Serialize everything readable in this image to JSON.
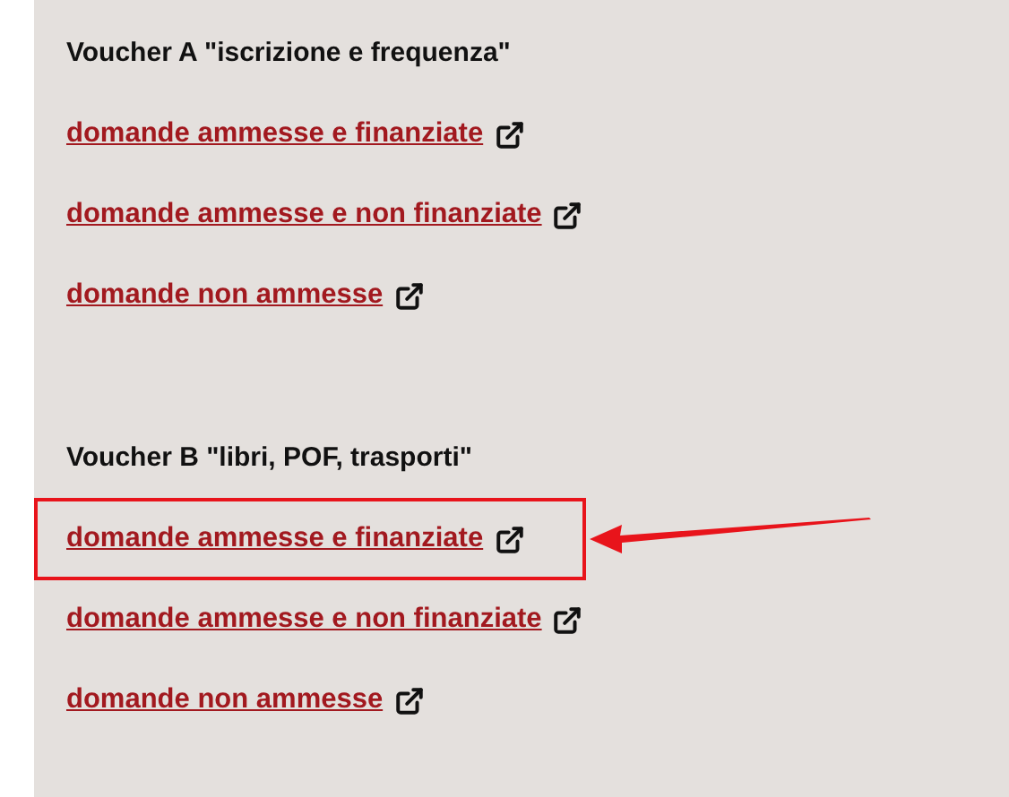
{
  "sections": [
    {
      "title": "Voucher A \"iscrizione e frequenza\"",
      "links": [
        {
          "label": "domande ammesse e finanziate",
          "highlighted": false
        },
        {
          "label": "domande ammesse e non finanziate",
          "highlighted": false
        },
        {
          "label": "domande non ammesse",
          "highlighted": false
        }
      ]
    },
    {
      "title": "Voucher B \"libri, POF, trasporti\"",
      "links": [
        {
          "label": "domande ammesse e finanziate",
          "highlighted": true
        },
        {
          "label": "domande ammesse e non finanziate",
          "highlighted": false
        },
        {
          "label": "domande non ammesse",
          "highlighted": false
        }
      ]
    }
  ]
}
